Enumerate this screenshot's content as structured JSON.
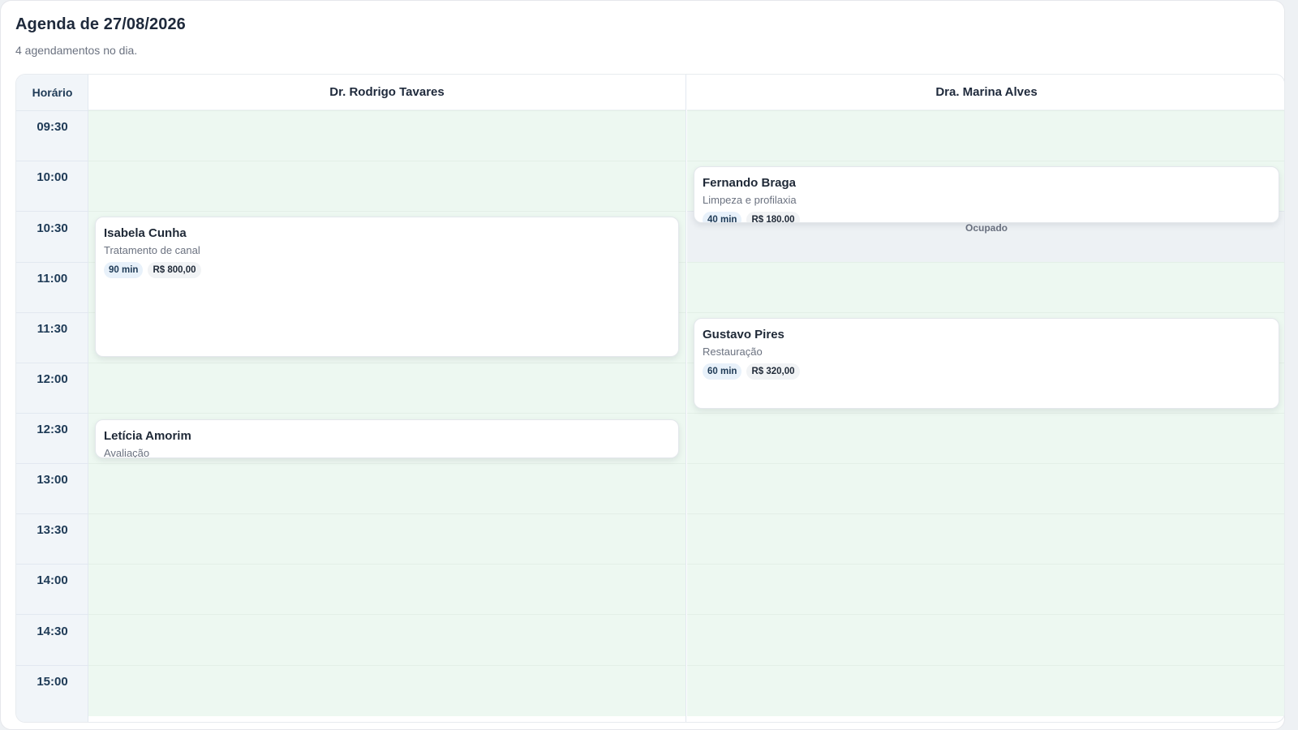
{
  "header": {
    "title": "Agenda de 27/08/2026",
    "subtitle": "4 agendamentos no dia."
  },
  "grid": {
    "time_header": "Horário",
    "times": [
      "09:30",
      "10:00",
      "10:30",
      "11:00",
      "11:30",
      "12:00",
      "12:30",
      "13:00",
      "13:30",
      "14:00",
      "14:30",
      "15:00"
    ],
    "professionals": [
      {
        "name": "Dr. Rodrigo Tavares"
      },
      {
        "name": "Dra. Marina Alves",
        "busy_label": "Ocupado"
      }
    ]
  },
  "appointments": {
    "isabela": {
      "patient": "Isabela Cunha",
      "service": "Tratamento de canal",
      "duration": "90 min",
      "price": "R$ 800,00"
    },
    "leticia": {
      "patient": "Letícia Amorim",
      "service": "Avaliação"
    },
    "fernando": {
      "patient": "Fernando Braga",
      "service": "Limpeza e profilaxia",
      "duration": "40 min",
      "price": "R$ 180,00"
    },
    "gustavo": {
      "patient": "Gustavo Pires",
      "service": "Restauração",
      "duration": "60 min",
      "price": "R$ 320,00"
    }
  },
  "colors": {
    "free_slot": "#edf8f1",
    "busy_slot": "#edf1f4",
    "time_column": "#f1f5f9",
    "duration_tag": "#e8f1fa"
  }
}
